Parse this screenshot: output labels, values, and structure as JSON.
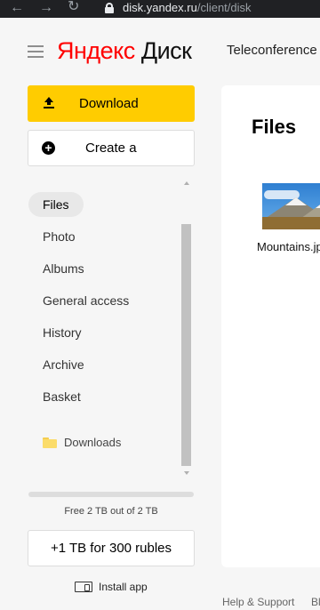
{
  "browser": {
    "url_host": "disk.yandex.ru",
    "url_path": "/client/disk"
  },
  "header": {
    "logo_red": "Яндекс",
    "logo_black": "Диск",
    "tab_label": "Teleconference"
  },
  "sidebar": {
    "download_label": "Download",
    "create_label": "Create a",
    "items": [
      {
        "label": "Files",
        "active": true
      },
      {
        "label": "Photo"
      },
      {
        "label": "Albums"
      },
      {
        "label": "General access"
      },
      {
        "label": "History"
      },
      {
        "label": "Archive"
      },
      {
        "label": "Basket"
      }
    ],
    "folder_label": "Downloads",
    "quota_text": "Free 2 TB out of 2 TB",
    "quota_used_fraction": 0,
    "buy_label": "+1 TB for 300 rubles",
    "install_label": "Install app"
  },
  "main": {
    "title": "Files",
    "files": [
      {
        "name": "Mountains.jpg"
      }
    ]
  },
  "footer": {
    "help_label": "Help & Support",
    "extra_label": "Bl"
  },
  "colors": {
    "accent": "#ffcc00",
    "logo_red": "#ff0000",
    "background": "#f6f6f6"
  }
}
